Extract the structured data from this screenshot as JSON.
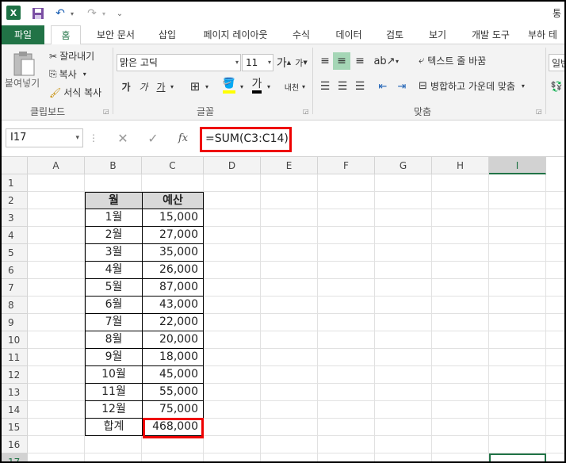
{
  "title_bar": {
    "app_icon": "excel-icon",
    "title_fragment": "통"
  },
  "tabs": [
    {
      "label": "파일"
    },
    {
      "label": "홈"
    },
    {
      "label": "보안 문서"
    },
    {
      "label": "삽입"
    },
    {
      "label": "페이지 레이아웃"
    },
    {
      "label": "수식"
    },
    {
      "label": "데이터"
    },
    {
      "label": "검토"
    },
    {
      "label": "보기"
    },
    {
      "label": "개발 도구"
    },
    {
      "label": "부하 테"
    }
  ],
  "ribbon": {
    "clipboard": {
      "paste": "붙여넣기",
      "cut": "잘라내기",
      "copy": "복사",
      "format_painter": "서식 복사",
      "group_label": "클립보드"
    },
    "font": {
      "font_name": "맑은 고딕",
      "font_size": "11",
      "bold": "가",
      "italic": "가",
      "underline": "가",
      "grow": "가",
      "shrink": "가",
      "font_color": "가",
      "phonetic": "내천",
      "group_label": "글꼴"
    },
    "alignment": {
      "wrap_text": "텍스트 줄 바꿈",
      "merge_center": "병합하고 가운데 맞춤",
      "group_label": "맞춤"
    },
    "number": {
      "format": "일반"
    }
  },
  "formula_bar": {
    "name_box": "I17",
    "fx": "fx",
    "formula": "=SUM(C3:C14)"
  },
  "columns": [
    "A",
    "B",
    "C",
    "D",
    "E",
    "F",
    "G",
    "H",
    "I"
  ],
  "rows": [
    "1",
    "2",
    "3",
    "4",
    "5",
    "6",
    "7",
    "8",
    "9",
    "10",
    "11",
    "12",
    "13",
    "14",
    "15",
    "16",
    "17"
  ],
  "table": {
    "headers": [
      "월",
      "예산"
    ],
    "rows": [
      {
        "month": "1월",
        "budget": "15,000"
      },
      {
        "month": "2월",
        "budget": "27,000"
      },
      {
        "month": "3월",
        "budget": "35,000"
      },
      {
        "month": "4월",
        "budget": "26,000"
      },
      {
        "month": "5월",
        "budget": "87,000"
      },
      {
        "month": "6월",
        "budget": "43,000"
      },
      {
        "month": "7월",
        "budget": "22,000"
      },
      {
        "month": "8월",
        "budget": "20,000"
      },
      {
        "month": "9월",
        "budget": "18,000"
      },
      {
        "month": "10월",
        "budget": "45,000"
      },
      {
        "month": "11월",
        "budget": "55,000"
      },
      {
        "month": "12월",
        "budget": "75,000"
      }
    ],
    "total_label": "합계",
    "total_value": "468,000"
  },
  "colors": {
    "excel_green": "#217346",
    "highlight_red": "#e00000",
    "header_fill": "#d9d9d9"
  }
}
